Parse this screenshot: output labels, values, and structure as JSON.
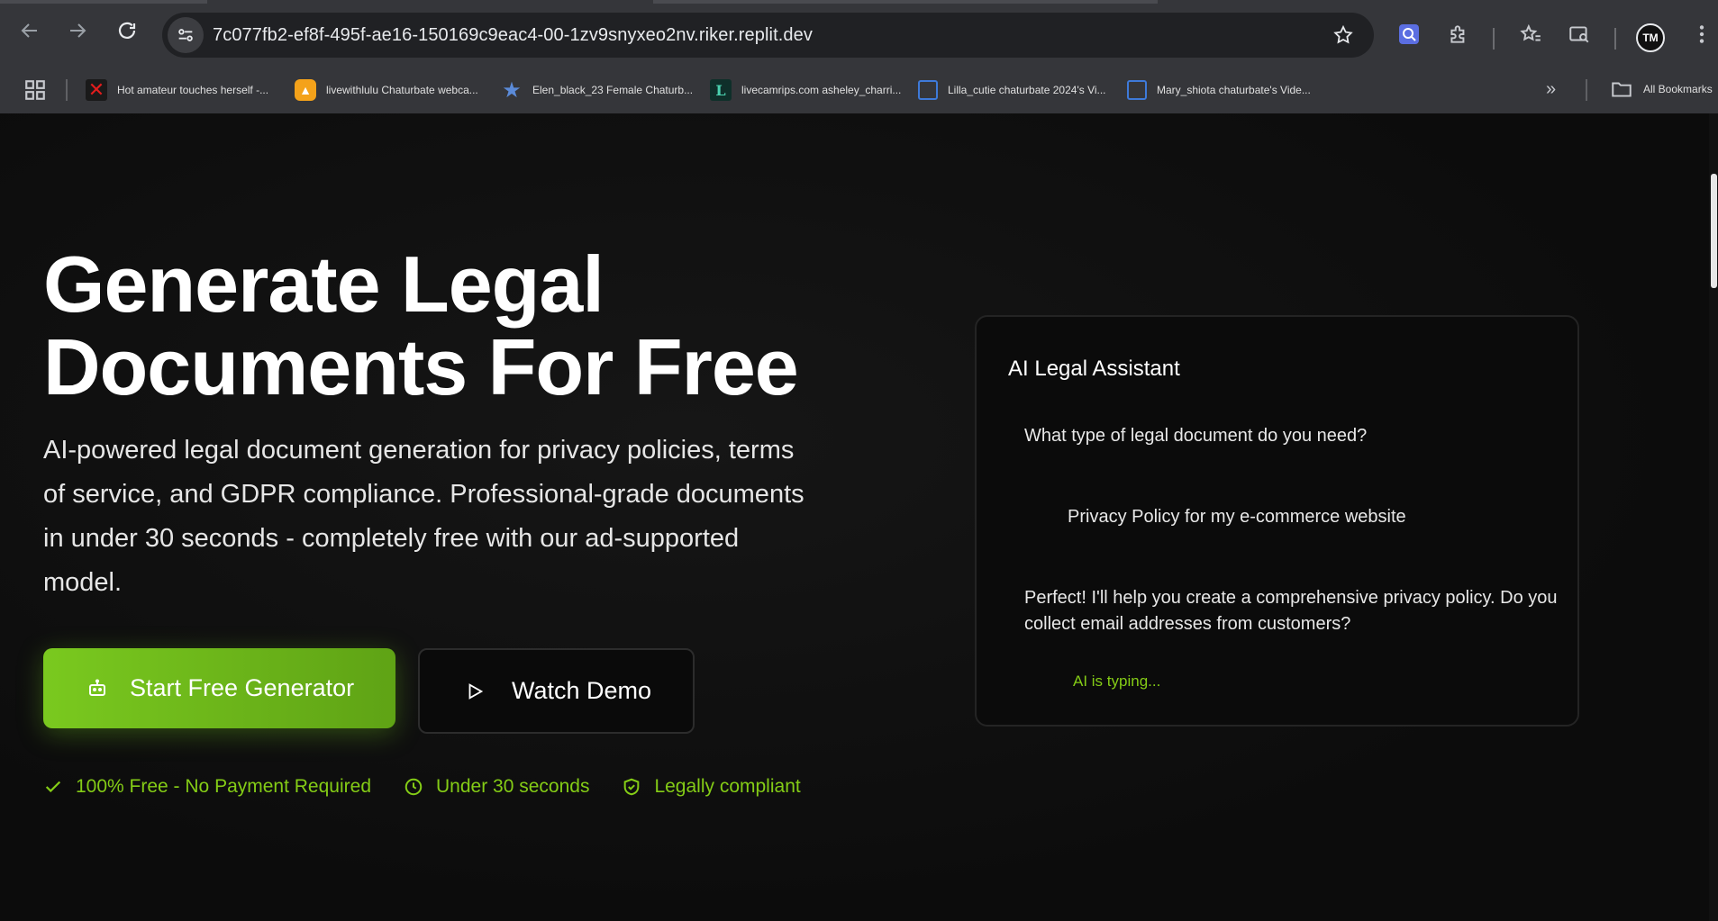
{
  "browser": {
    "url": "7c077fb2-ef8f-495f-ae16-150169c9eac4-00-1zv9snyxeo2nv.riker.replit.dev",
    "bookmarks": [
      {
        "label": "Hot amateur touches herself -...",
        "icon": "x-icon"
      },
      {
        "label": "livewithlulu Chaturbate webca...",
        "icon": "triangle-icon"
      },
      {
        "label": "Elen_black_23 Female Chaturb...",
        "icon": "star-icon"
      },
      {
        "label": "livecamrips.com asheley_charri...",
        "icon": "l-letter-icon"
      },
      {
        "label": "Lilla_cutie chaturbate 2024's Vi...",
        "icon": "square-icon"
      },
      {
        "label": "Mary_shiota chaturbate's Vide...",
        "icon": "square-icon"
      }
    ],
    "all_bookmarks_label": "All Bookmarks",
    "profile_initials": "TM"
  },
  "hero": {
    "title": "Generate Legal Documents For Free",
    "description": "AI-powered legal document generation for privacy policies, terms of service, and GDPR compliance. Professional-grade documents in under 30 seconds - completely free with our ad-supported model.",
    "primary_button": "Start Free Generator",
    "secondary_button": "Watch Demo",
    "features": [
      "100% Free - No Payment Required",
      "Under 30 seconds",
      "Legally compliant"
    ]
  },
  "assistant": {
    "title": "AI Legal Assistant",
    "messages": [
      "What type of legal document do you need?",
      "Privacy Policy for my e-commerce website",
      "Perfect! I'll help you create a comprehensive privacy policy. Do you collect email addresses from customers?"
    ],
    "typing_status": "AI is typing..."
  },
  "colors": {
    "accent": "#84cc16",
    "background": "#0f0f0f",
    "chrome": "#35363a"
  }
}
